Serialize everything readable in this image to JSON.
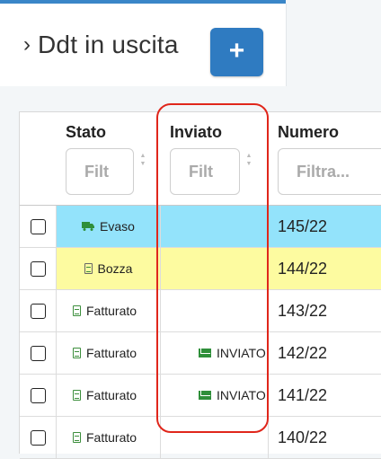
{
  "header": {
    "title": "Ddt in uscita",
    "add_button": "+"
  },
  "colors": {
    "evaso_row": "#93e3fb",
    "bozza_row": "#fdfba0",
    "accent": "#2f7bc1",
    "highlight": "#e0261b"
  },
  "columns": [
    {
      "label": "Stato",
      "filter_placeholder": "Filt"
    },
    {
      "label": "Inviato",
      "filter_placeholder": "Filt"
    },
    {
      "label": "Numero",
      "filter_placeholder": "Filtra..."
    }
  ],
  "rows": [
    {
      "stato": "Evaso",
      "stato_icon": "truck-icon",
      "inviato": "",
      "numero": "145/22"
    },
    {
      "stato": "Bozza",
      "stato_icon": "document-icon",
      "inviato": "",
      "numero": "144/22"
    },
    {
      "stato": "Fatturato",
      "stato_icon": "document-icon",
      "inviato": "",
      "numero": "143/22"
    },
    {
      "stato": "Fatturato",
      "stato_icon": "document-icon",
      "inviato": "INVIATO",
      "numero": "142/22"
    },
    {
      "stato": "Fatturato",
      "stato_icon": "document-icon",
      "inviato": "INVIATO",
      "numero": "141/22"
    },
    {
      "stato": "Fatturato",
      "stato_icon": "document-icon",
      "inviato": "",
      "numero": "140/22"
    }
  ]
}
